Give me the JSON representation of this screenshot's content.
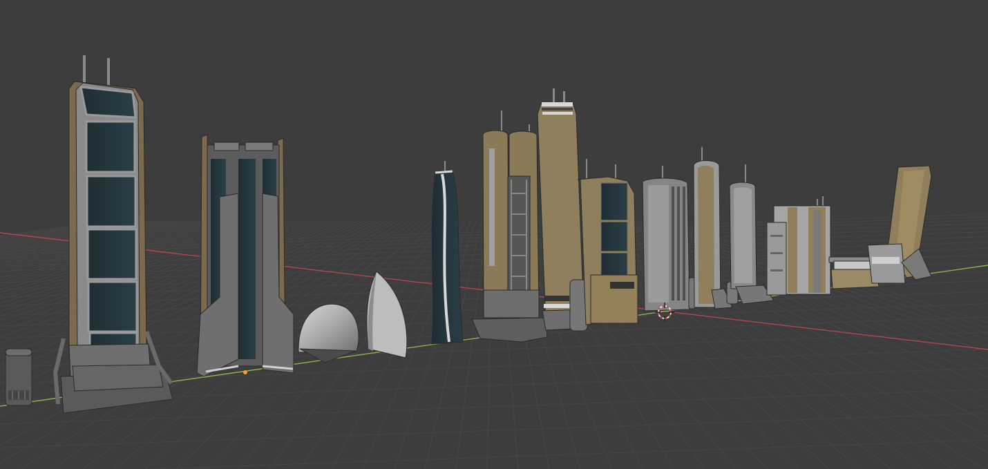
{
  "viewport": {
    "background": "#3d3d3d",
    "grid_color": "#474747",
    "x_axis_color": "#b3474f",
    "y_axis_color": "#8bb54a"
  },
  "scene_objects": [
    {
      "id": "canister-small",
      "material": "gray-metal"
    },
    {
      "id": "tower-twin-antenna-glass",
      "material": "tan-panel-dark-glass"
    },
    {
      "id": "tower-vertical-fins",
      "material": "gray-tan-dark-glass"
    },
    {
      "id": "dome-quarter-sphere",
      "material": "gray-shaded"
    },
    {
      "id": "shell-fin",
      "material": "light-gray"
    },
    {
      "id": "tower-twisted-glass",
      "material": "dark-glass-white-trim"
    },
    {
      "id": "tower-twin-cylinders-lattice",
      "material": "tan-gray"
    },
    {
      "id": "tower-tall-tapered",
      "material": "tan"
    },
    {
      "id": "tower-stepped-glass",
      "material": "tan-dark-glass"
    },
    {
      "id": "tower-ribbed-gray",
      "material": "gray"
    },
    {
      "id": "tower-rounded-slab-tan",
      "material": "tan-gray"
    },
    {
      "id": "tower-rounded-slab-gray",
      "material": "gray"
    },
    {
      "id": "block-cluster",
      "material": "tan-gray"
    },
    {
      "id": "pavilion-low",
      "material": "tan-gray"
    },
    {
      "id": "tower-leaning",
      "material": "tan-gray"
    }
  ],
  "icons": {
    "cursor": "3d-cursor-icon",
    "origin": "object-origin-icon"
  }
}
